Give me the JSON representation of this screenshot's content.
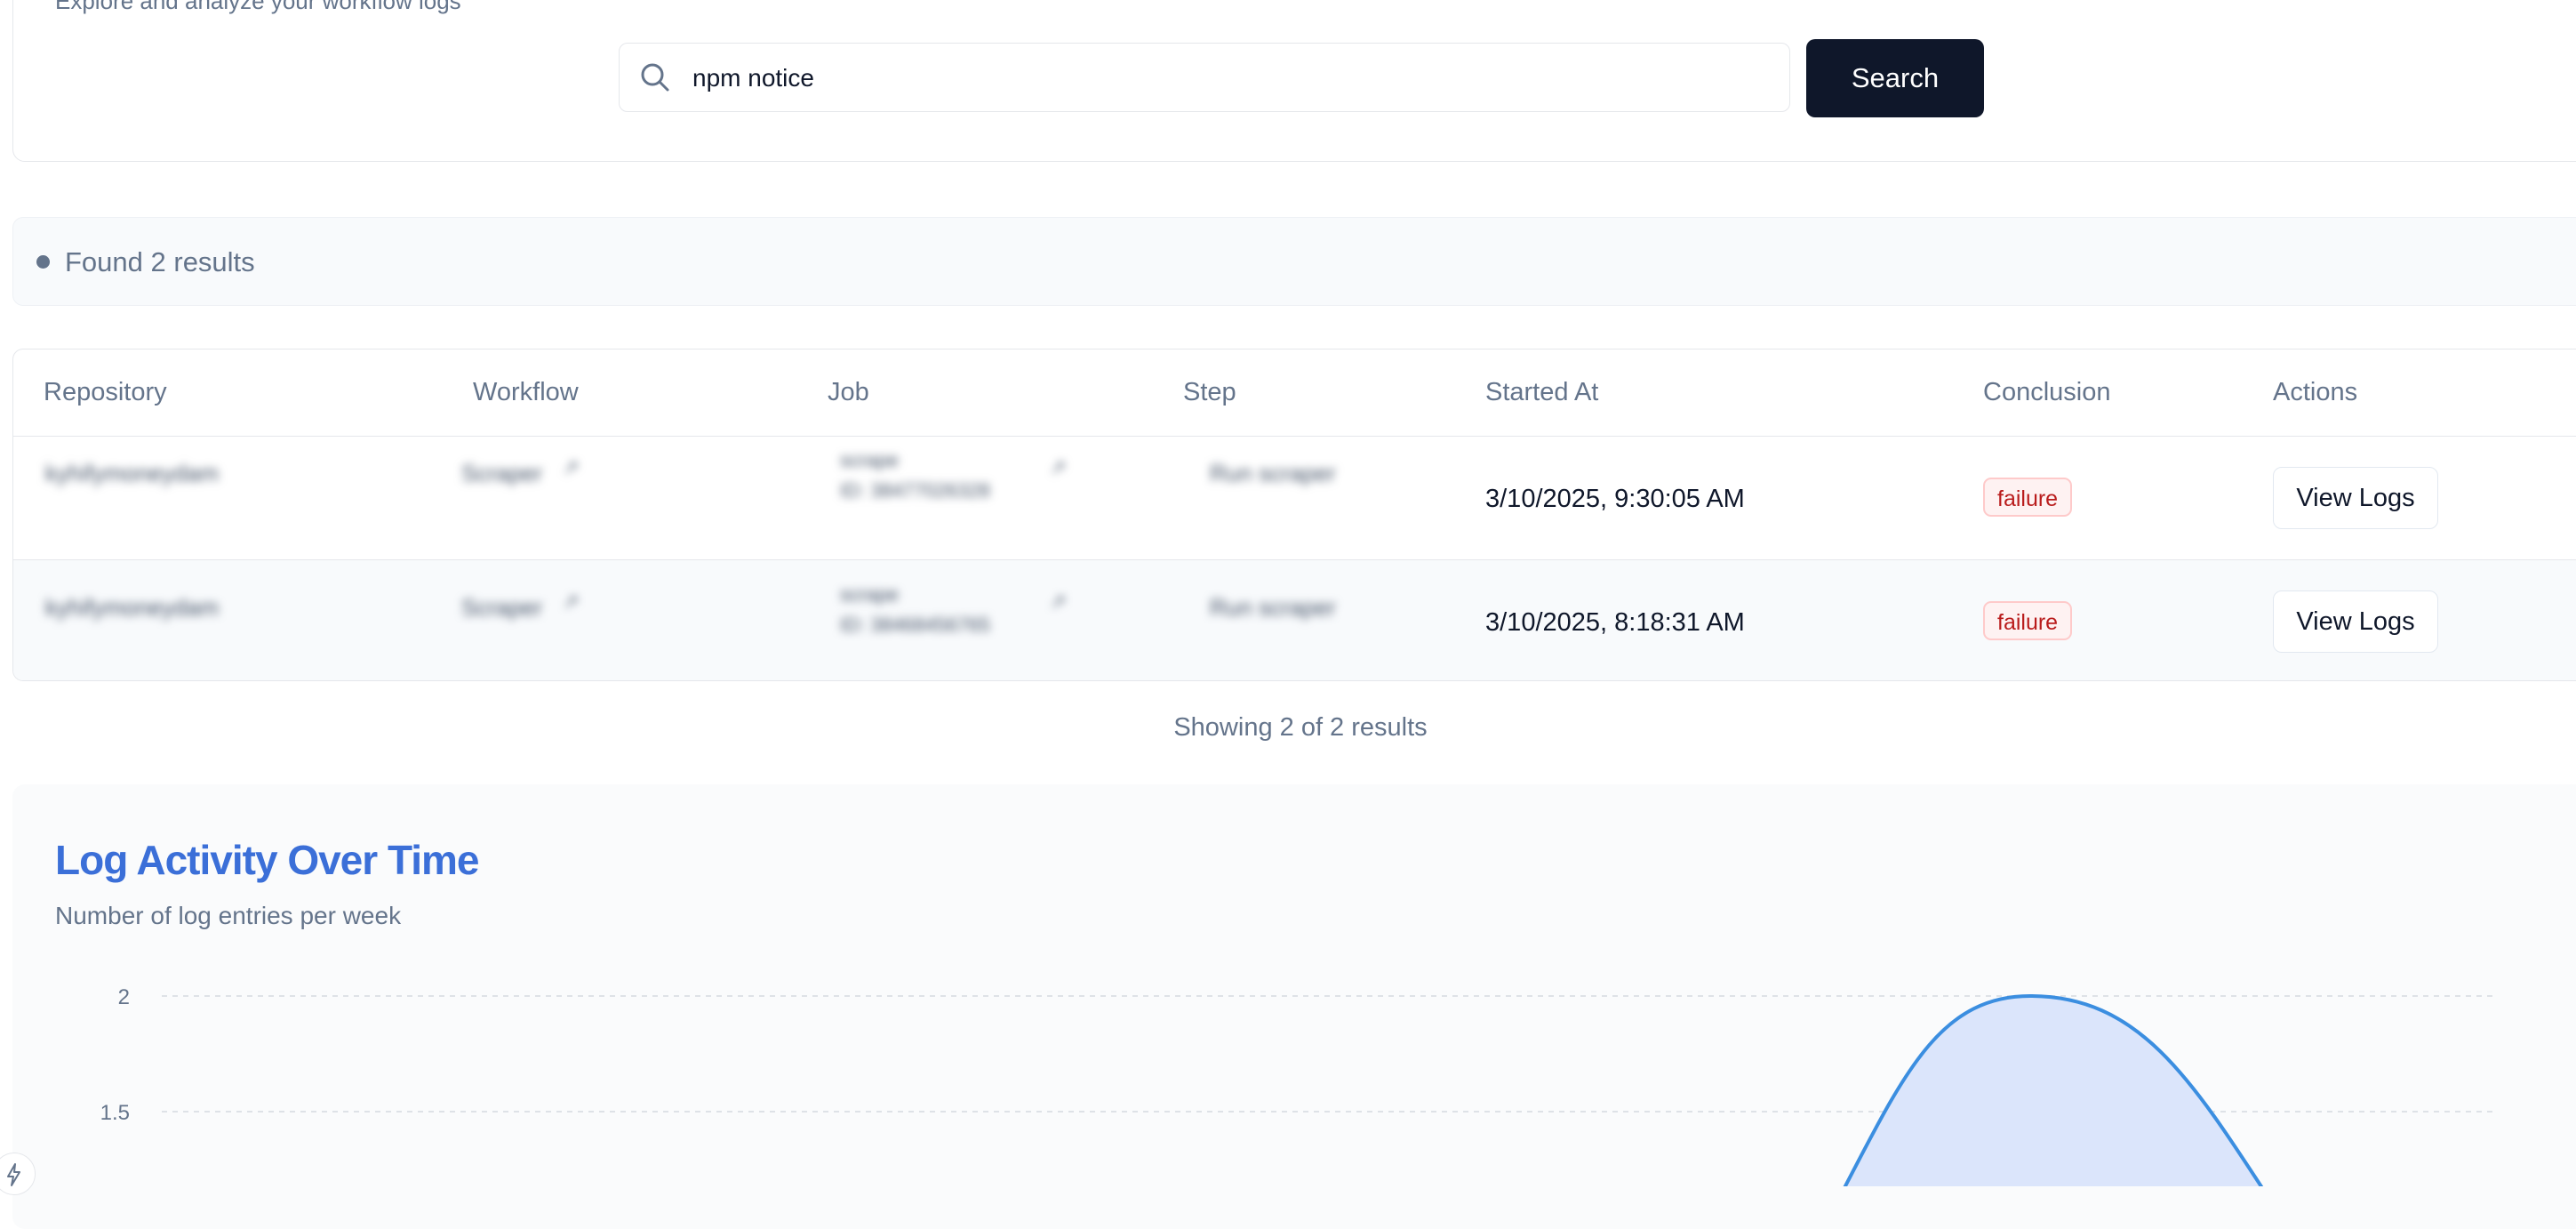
{
  "header": {
    "subtitle": "Explore and analyze your workflow logs"
  },
  "search": {
    "value": "npm notice",
    "button_label": "Search",
    "icon": "search-icon"
  },
  "results": {
    "summary": "Found 2 results",
    "columns": [
      "Repository",
      "Workflow",
      "Job",
      "Step",
      "Started At",
      "Conclusion",
      "Actions"
    ],
    "rows": [
      {
        "repository": "kyhifymoneydam",
        "workflow": "Scraper",
        "job": "scrape",
        "job_id": "ID: 38477026328",
        "step": "Run scraper",
        "started_at": "3/10/2025, 9:30:05 AM",
        "conclusion": "failure",
        "action": "View Logs"
      },
      {
        "repository": "kyhifymoneydam",
        "workflow": "Scraper",
        "job": "scrape",
        "job_id": "ID: 38468456765",
        "step": "Run scraper",
        "started_at": "3/10/2025, 8:18:31 AM",
        "conclusion": "failure",
        "action": "View Logs"
      }
    ],
    "footer": "Showing 2 of 2 results"
  },
  "chart": {
    "title": "Log Activity Over Time",
    "subtitle": "Number of log entries per week"
  },
  "chart_data": {
    "type": "area",
    "title": "Log Activity Over Time",
    "subtitle": "Number of log entries per week",
    "y_ticks": [
      "2",
      "1.5"
    ],
    "ylim": [
      0,
      2
    ],
    "series": [
      {
        "values": [
          0,
          2,
          0
        ]
      }
    ],
    "colors": {
      "line": "#3b8ee0",
      "fill": "#dbe5fb",
      "grid": "#d4d9e0"
    },
    "grid": true
  }
}
